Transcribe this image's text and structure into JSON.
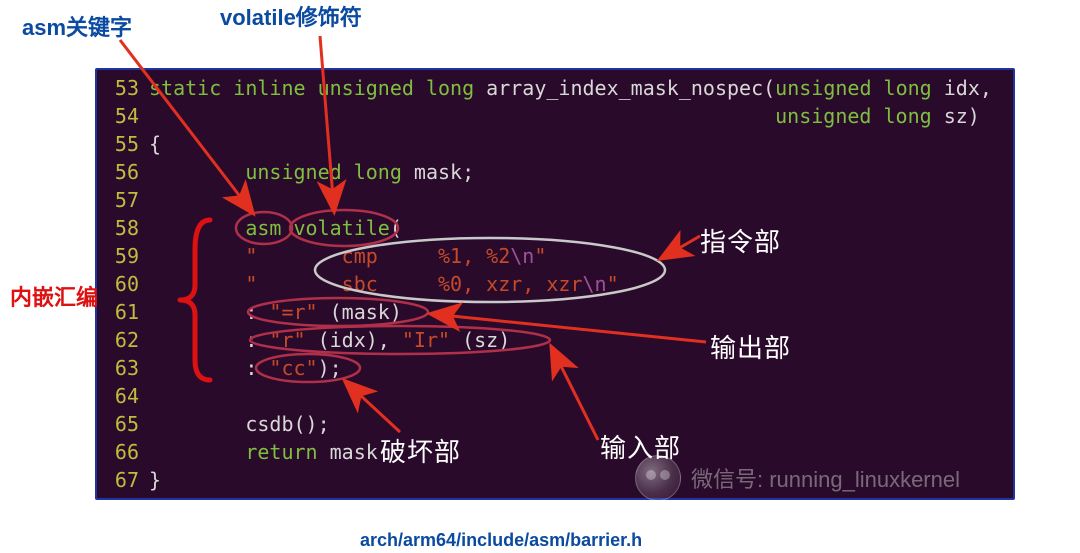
{
  "labels": {
    "asm": "asm关键字",
    "volatile": "volatile修饰符",
    "inline_asm": "内嵌汇编",
    "instr": "指令部",
    "output": "输出部",
    "input": "输入部",
    "destroy": "破坏部"
  },
  "source_path": "arch/arm64/include/asm/barrier.h",
  "watermark": "微信号: running_linuxkernel",
  "code": {
    "line_numbers": [
      "53",
      "54",
      "55",
      "56",
      "57",
      "58",
      "59",
      "60",
      "61",
      "62",
      "63",
      "64",
      "65",
      "66",
      "67"
    ],
    "l53": {
      "static": "static",
      "inline": " inline",
      "ulong1": " unsigned",
      "ulong2": " long",
      "fn": " array_index_mask_nospec(",
      "uns": "unsigned",
      "lng": " long",
      "idx": " idx,"
    },
    "l54": {
      "pad": "                                                    ",
      "uns": "unsigned",
      "lng": " long",
      "sz": " sz)"
    },
    "l55": "{",
    "l56": {
      "indent": "        ",
      "uns": "unsigned",
      "lng": " long",
      "mask": " mask;"
    },
    "l57": "",
    "l58": {
      "indent": "        ",
      "asm": "asm",
      "space": " ",
      "volatile": "volatile",
      "paren": "("
    },
    "l59": {
      "indent": "        ",
      "q": "\"",
      "body": "       cmp     %1, %2",
      "esc": "\\n",
      "q2": "\""
    },
    "l60": {
      "indent": "        ",
      "q": "\"",
      "body": "       sbc     %0, xzr, xzr",
      "esc": "\\n",
      "q2": "\""
    },
    "l61": {
      "indent": "        : ",
      "q": "\"=r\"",
      "rest": " (mask)"
    },
    "l62": {
      "indent": "        : ",
      "q1": "\"r\"",
      "a": " (idx), ",
      "q2": "\"Ir\"",
      "b": " (sz)"
    },
    "l63": {
      "indent": "        : ",
      "q": "\"cc\"",
      "end": ");"
    },
    "l64": "",
    "l65": {
      "indent": "        ",
      "csdb": "csdb();"
    },
    "l66": {
      "indent": "        ",
      "ret": "return",
      "mask": " mask;"
    },
    "l67": "}"
  }
}
